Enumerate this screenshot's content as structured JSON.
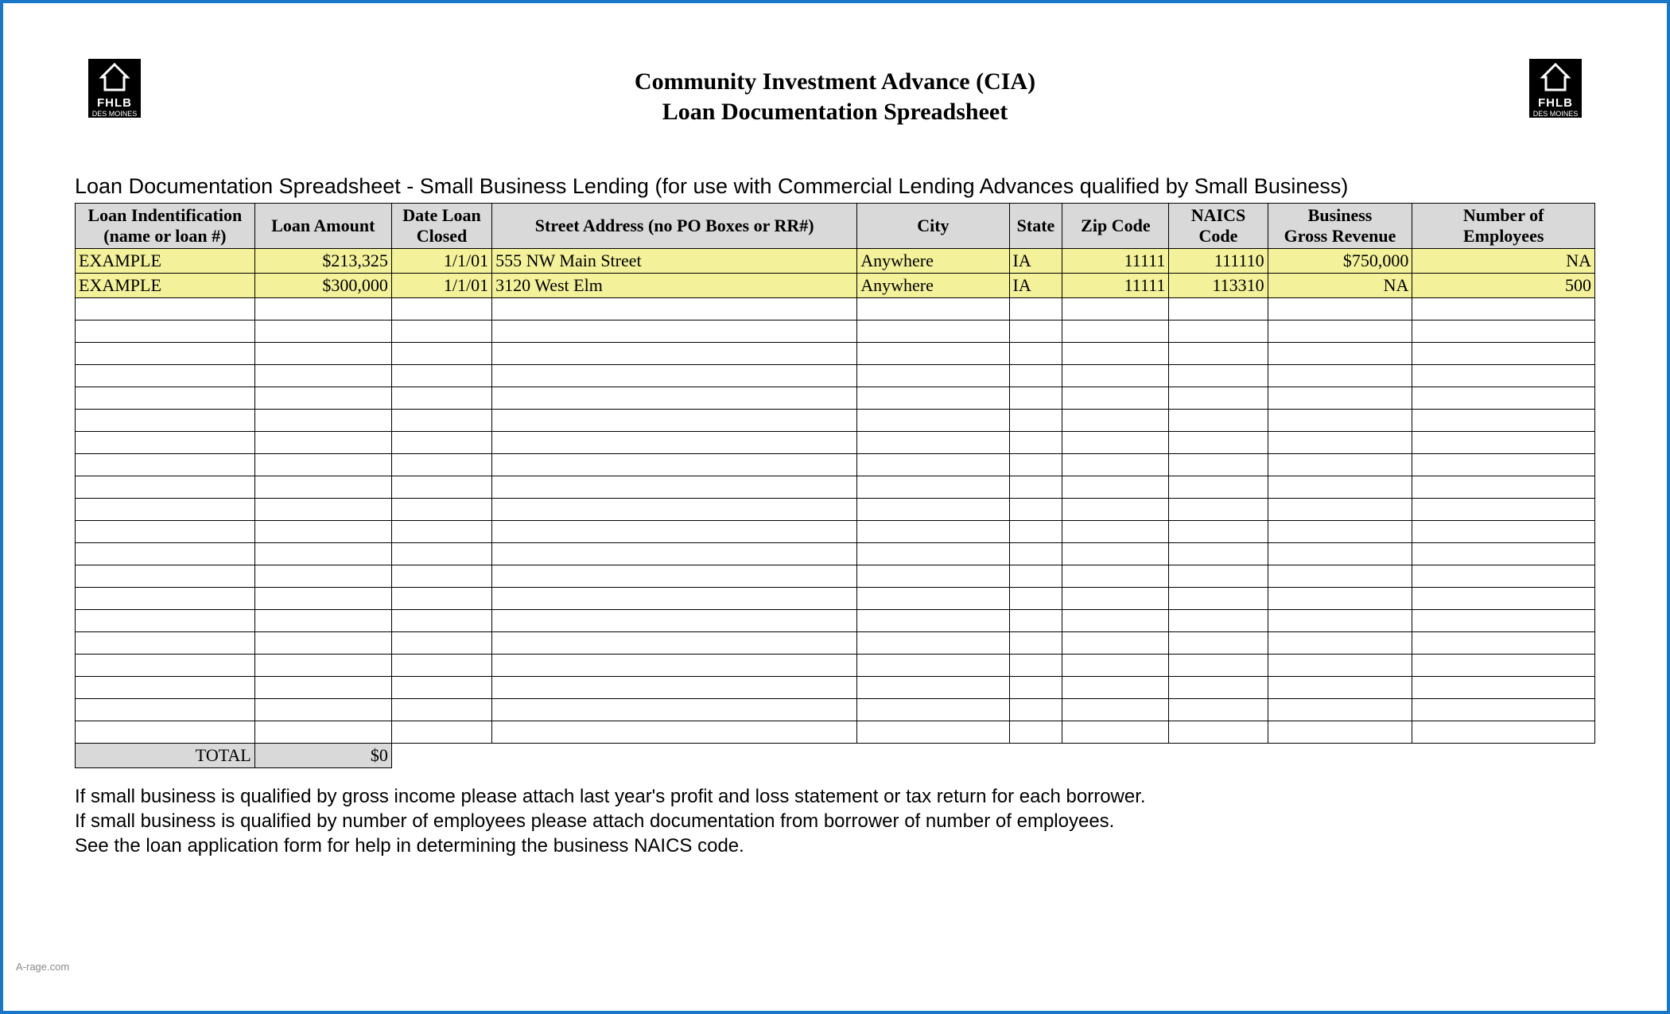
{
  "header": {
    "title_line1": "Community Investment Advance (CIA)",
    "title_line2": "Loan Documentation Spreadsheet",
    "logo_text_big": "FHLB",
    "logo_text_small": "DES MOINES"
  },
  "subtitle": "Loan Documentation Spreadsheet - Small Business Lending (for use with Commercial Lending Advances qualified by Small Business)",
  "columns": {
    "c1a": "Loan Indentification",
    "c1b": "(name or loan #)",
    "c2": "Loan Amount",
    "c3a": "Date Loan",
    "c3b": "Closed",
    "c4": "Street Address (no PO Boxes or RR#)",
    "c5": "City",
    "c6": "State",
    "c7": "Zip Code",
    "c8a": "NAICS",
    "c8b": "Code",
    "c9a": "Business",
    "c9b": "Gross Revenue",
    "c10a": "Number of",
    "c10b": "Employees"
  },
  "rows": [
    {
      "id": "EXAMPLE",
      "amount": "$213,325",
      "date": "1/1/01",
      "address": "555 NW Main Street",
      "city": "Anywhere",
      "state": "IA",
      "zip": "11111",
      "naics": "111110",
      "revenue": "$750,000",
      "employees": "NA"
    },
    {
      "id": "EXAMPLE",
      "amount": "$300,000",
      "date": "1/1/01",
      "address": "3120 West Elm",
      "city": "Anywhere",
      "state": "IA",
      "zip": "11111",
      "naics": "113310",
      "revenue": "NA",
      "employees": "500"
    }
  ],
  "empty_row_count": 20,
  "total": {
    "label": "TOTAL",
    "amount": "$0"
  },
  "footer": {
    "line1": "If small business is qualified by gross income please attach last year's profit and loss statement or tax return for each borrower.",
    "line2": "If small business is qualified by number of employees please attach documentation from borrower of number of employees.",
    "line3": "See the loan application form for help in determining the business NAICS code."
  },
  "watermark": "A-rage.com"
}
